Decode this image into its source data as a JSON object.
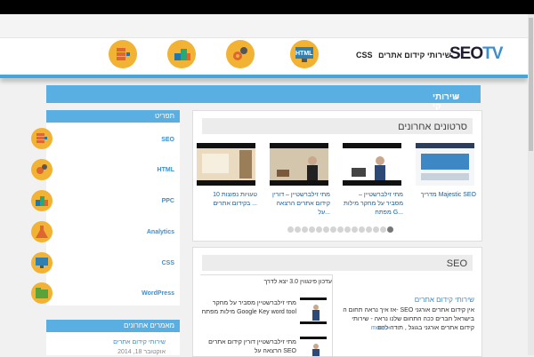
{
  "header": {
    "logo_text": "SEO",
    "logo_accent": "TV",
    "nav_services": "שירותי קידום אתרים",
    "nav_css": "CSS",
    "nav_html": "HTML",
    "circle_icons": [
      "gears-icon",
      "blocks-icon",
      "list-icon"
    ]
  },
  "breadcrumb": {
    "arrow": "»",
    "label": "שירותי קי"
  },
  "videos": {
    "title": "סרטונים אחרונים",
    "items": [
      {
        "caption": "מדריך Majestic SEO"
      },
      {
        "caption": "מתי זילברשטיין – מסביר על מחקר מילות מפתח G..."
      },
      {
        "caption": "מתי זילברשטיין – דורין קידום אתרים הרצאה על..."
      },
      {
        "caption": "10 טעויות נפוצות בקידום אתרים ..."
      }
    ],
    "dot_count": 15
  },
  "seo_panel": {
    "title": "SEO",
    "headline": "עדכון פינגווין 3.0 יצא לדרך",
    "article_title": "שירותי קידום אתרים",
    "article_text": "אז איך נראה תחום ה- SEO אין קידום אתרים אורגני בישראל חברים ככה התחום שלנו נראה - שירותי קידום אתרים אורגני בגוגל , תודה לכם",
    "more": "more »",
    "video_items": [
      {
        "text": "מתי זילברשטיין מסביר על מחקר מילות מפתח Google Key word tool"
      },
      {
        "text": "מתי זילברשטיין דורין קידום אתרים הרצאה על SEO"
      }
    ]
  },
  "sidebar": {
    "title": "תפריט",
    "items": [
      "SEO",
      "HTML",
      "PPC",
      "Analytics",
      "CSS",
      "WordPress"
    ],
    "icons": [
      "seo-stack-icon",
      "gears-icon",
      "blocks-icon",
      "flask-icon",
      "monitor-icon",
      "folder-icon"
    ]
  },
  "recent": {
    "title": "מאמרים אחרונים",
    "item": "שירותי קידום אתרים",
    "date": "אוקטובר 18, 2014"
  }
}
